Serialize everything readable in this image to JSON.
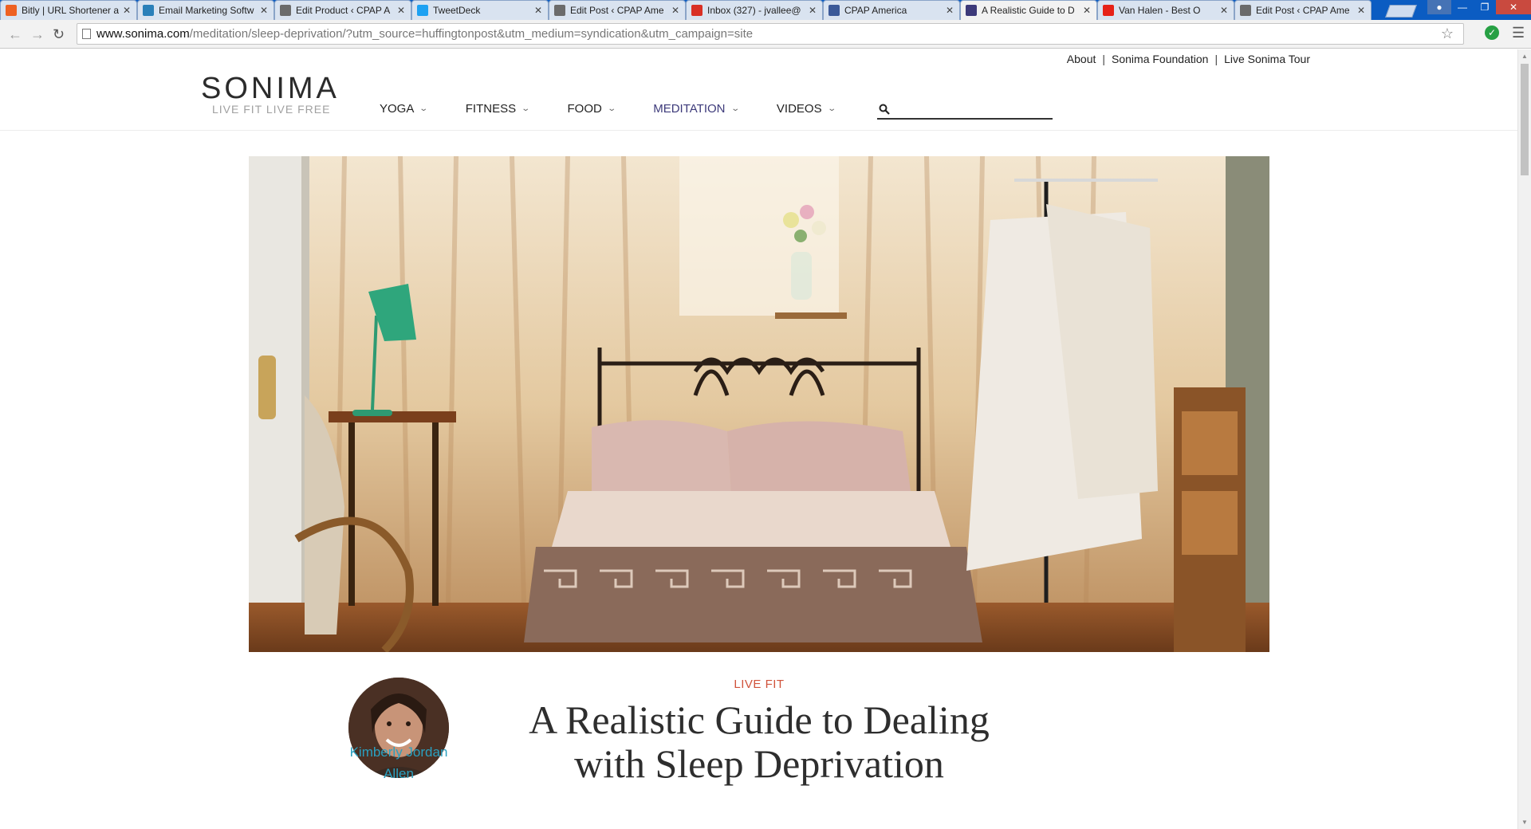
{
  "browser": {
    "tabs": [
      {
        "title": "Bitly | URL Shortener a",
        "favicon_color": "#ee6123"
      },
      {
        "title": "Email Marketing Softw",
        "favicon_color": "#2a80b9"
      },
      {
        "title": "Edit Product ‹ CPAP A",
        "favicon_color": "#6b6b6b"
      },
      {
        "title": "TweetDeck",
        "favicon_color": "#1da1f2"
      },
      {
        "title": "Edit Post ‹ CPAP Ame",
        "favicon_color": "#6b6b6b"
      },
      {
        "title": "Inbox (327) - jvallee@",
        "favicon_color": "#d93025"
      },
      {
        "title": "CPAP America",
        "favicon_color": "#3b5998"
      },
      {
        "title": "A Realistic Guide to D",
        "favicon_color": "#3d3a7a",
        "active": true
      },
      {
        "title": "Van Halen - Best O",
        "favicon_color": "#e62117"
      },
      {
        "title": "Edit Post ‹ CPAP Ame",
        "favicon_color": "#6b6b6b"
      }
    ],
    "url_host": "www.sonima.com",
    "url_path": "/meditation/sleep-deprivation/?utm_source=huffingtonpost&utm_medium=syndication&utm_campaign=site"
  },
  "site": {
    "logo": "SONIMA",
    "tagline": "LIVE FIT  LIVE FREE",
    "top_links": [
      "About",
      "Sonima Foundation",
      "Live Sonima Tour"
    ],
    "nav": [
      "YOGA",
      "FITNESS",
      "FOOD",
      "MEDITATION",
      "VIDEOS"
    ],
    "active_nav": "MEDITATION",
    "accent_color": "#3d3a7a"
  },
  "article": {
    "kicker": "LIVE FIT",
    "title_line1": "A Realistic Guide to Dealing",
    "title_line2": "with Sleep Deprivation",
    "author_line1": "Kimberly Jordan",
    "author_line2": "Allen"
  }
}
